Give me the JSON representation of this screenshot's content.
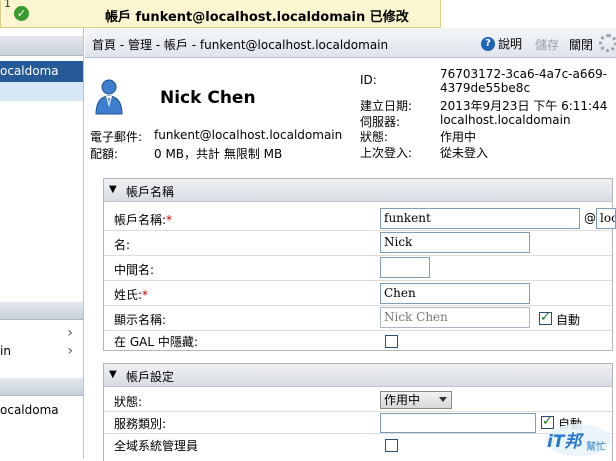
{
  "toast": {
    "corner_char": "1",
    "message": "帳戶 funkent@localhost.localdomain 已修改"
  },
  "leftnav": {
    "selected_label": "ocaldoma",
    "item_in": "in",
    "item_bottom": "ocaldoma"
  },
  "header": {
    "breadcrumb": "首頁 - 管理 - 帳戶 - funkent@localhost.localdomain",
    "help_label": "說明",
    "save_label": "儲存",
    "close_label": "關閉"
  },
  "account": {
    "display_name": "Nick Chen",
    "email_label": "電子郵件:",
    "email_value": "funkent@localhost.localdomain",
    "quota_label": "配額:",
    "quota_value": "0 MB，共計 無限制 MB",
    "id_label": "ID:",
    "id_value_line1": "76703172-3ca6-4a7c-a669-",
    "id_value_line2": "4379de55be8c",
    "created_label": "建立日期:",
    "created_value": "2013年9月23日 下午 6:11:44",
    "server_label": "伺服器:",
    "server_value": "localhost.localdomain",
    "status_label": "狀態:",
    "status_value": "作用中",
    "last_login_label": "上次登入:",
    "last_login_value": "從未登入"
  },
  "section_name": {
    "title": "帳戶名稱",
    "account_name_label": "帳戶名稱:",
    "account_name_value": "funkent",
    "at_sign": "@",
    "domain_value": "loc",
    "first_name_label": "名:",
    "first_name_value": "Nick",
    "middle_name_label": "中間名:",
    "middle_name_value": "",
    "last_name_label": "姓氏:",
    "last_name_value": "Chen",
    "display_name_label": "顯示名稱:",
    "display_name_value": "Nick Chen",
    "auto_label": "自動",
    "hide_gal_label": "在 GAL 中隱藏:"
  },
  "section_settings": {
    "title": "帳戶設定",
    "status_label": "狀態:",
    "status_value": "作用中",
    "cos_label": "服務類別:",
    "cos_value": "",
    "auto_label": "自動",
    "global_admin_label": "全域系統管理員"
  },
  "watermark": {
    "line1": "iT邦",
    "line2": "幫忙"
  },
  "colors": {
    "accent": "#265a96",
    "toast_bg": "#fbf6cf",
    "required": "#cc0000"
  }
}
